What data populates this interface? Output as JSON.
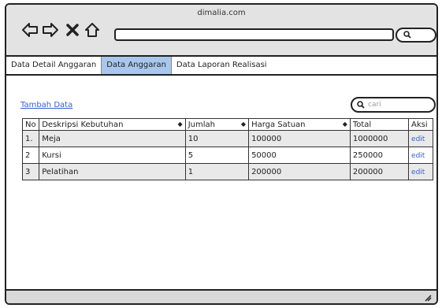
{
  "browser": {
    "site_title": "dimalia.com"
  },
  "tabs": [
    {
      "label": "Data Detail Anggaran",
      "active": false
    },
    {
      "label": "Data Anggaran",
      "active": true
    },
    {
      "label": "Data Laporan Realisasi",
      "active": false
    }
  ],
  "content": {
    "add_link": "Tambah Data",
    "search_placeholder": "cari"
  },
  "table": {
    "headers": [
      "No",
      "Deskripsi Kebutuhan",
      "Jumlah",
      "Harga Satuan",
      "Total",
      "Aksi"
    ],
    "rows": [
      {
        "no": "1.",
        "desc": "Meja",
        "qty": "10",
        "price": "100000",
        "total": "1000000",
        "action": "edit"
      },
      {
        "no": "2",
        "desc": "Kursi",
        "qty": "5",
        "price": "50000",
        "total": "250000",
        "action": "edit"
      },
      {
        "no": "3",
        "desc": "Pelatihan",
        "qty": "1",
        "price": "200000",
        "total": "200000",
        "action": "edit"
      }
    ]
  },
  "colors": {
    "active_tab": "#a9c7ec",
    "link": "#3a5fcd",
    "chrome": "#e3e3e3"
  }
}
